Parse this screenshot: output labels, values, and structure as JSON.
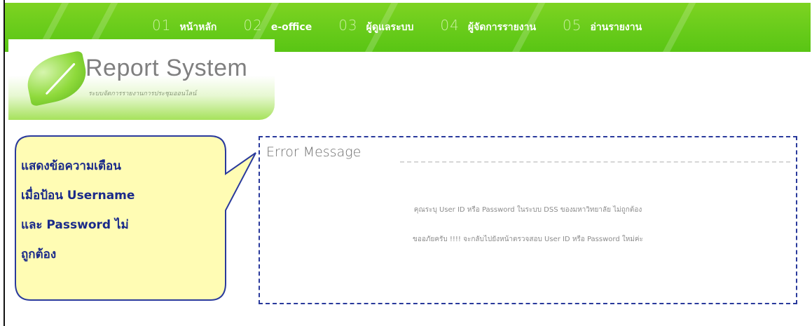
{
  "nav": {
    "items": [
      {
        "num": "01",
        "label": "หน้าหลัก"
      },
      {
        "num": "02",
        "label": "e-office"
      },
      {
        "num": "03",
        "label": "ผู้ดูแลระบบ"
      },
      {
        "num": "04",
        "label": "ผู้จัดการรายงาน"
      },
      {
        "num": "05",
        "label": "อ่านรายงาน"
      }
    ]
  },
  "logo": {
    "title": "Report System",
    "subtitle": "ระบบจัดการรายงานการประชุมออนไลน์"
  },
  "error": {
    "title": "Error Message",
    "line1": "คุณระบุ User ID หรือ Password ในระบบ DSS ของมหาวิทยาลัย ไม่ถูกต้อง",
    "line2": "ขออภัยครับ !!!! จะกลับไปยังหน้าตรวจสอบ User ID หรือ Password ใหม่ค่ะ"
  },
  "callout": {
    "line1": "แสดงข้อความเตือน",
    "line2": "เมื่อป้อน Username",
    "line3": "และ Password ไม่",
    "line4": "ถูกต้อง"
  },
  "colors": {
    "nav_green": "#6ccd1c",
    "callout_fill": "#fffcb4",
    "callout_border": "#2a3a9c",
    "error_border": "#2a3a9c"
  }
}
